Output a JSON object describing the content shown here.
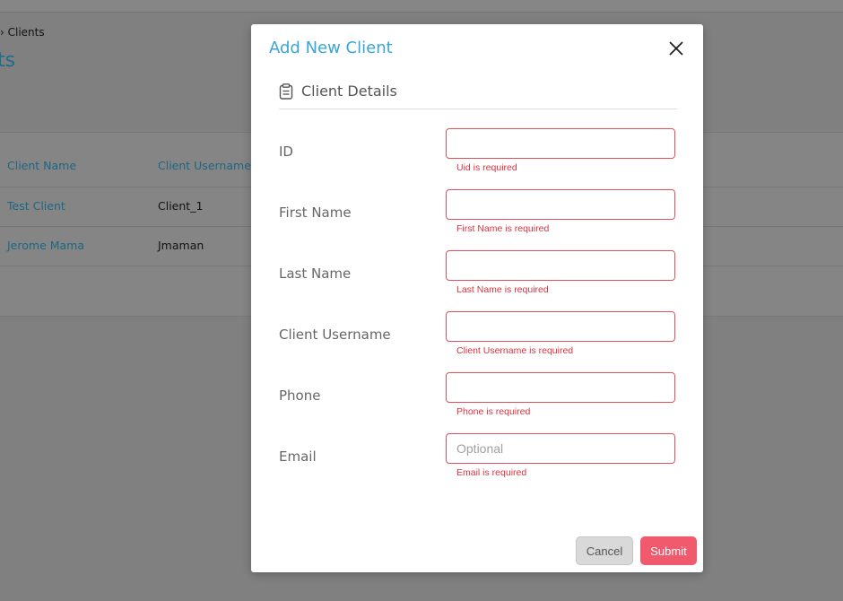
{
  "background": {
    "breadcrumb": "› Clients",
    "page_title": "ts",
    "table": {
      "columns": [
        "Client Name",
        "Client Username"
      ],
      "rows": [
        {
          "name": "Test Client",
          "username": "Client_1"
        },
        {
          "name": "Jerome Mama",
          "username": "Jmaman"
        }
      ]
    }
  },
  "modal": {
    "title": "Add New Client",
    "section_title": "Client Details",
    "fields": [
      {
        "label": "ID",
        "value": "",
        "placeholder": "",
        "error": "Uid is required"
      },
      {
        "label": "First Name",
        "value": "",
        "placeholder": "",
        "error": "First Name is required"
      },
      {
        "label": "Last Name",
        "value": "",
        "placeholder": "",
        "error": "Last Name is required"
      },
      {
        "label": "Client Username",
        "value": "",
        "placeholder": "",
        "error": "Client Username is required"
      },
      {
        "label": "Phone",
        "value": "",
        "placeholder": "",
        "error": "Phone is required"
      },
      {
        "label": "Email",
        "value": "",
        "placeholder": "Optional",
        "error": "Email is required"
      }
    ],
    "cancel_label": "Cancel",
    "submit_label": "Submit"
  },
  "colors": {
    "accent": "#39a7d6",
    "error": "#d8323f",
    "submit": "#ef5a6d",
    "overlay": "#808080"
  },
  "icons": [
    "close-icon",
    "clipboard-icon"
  ]
}
